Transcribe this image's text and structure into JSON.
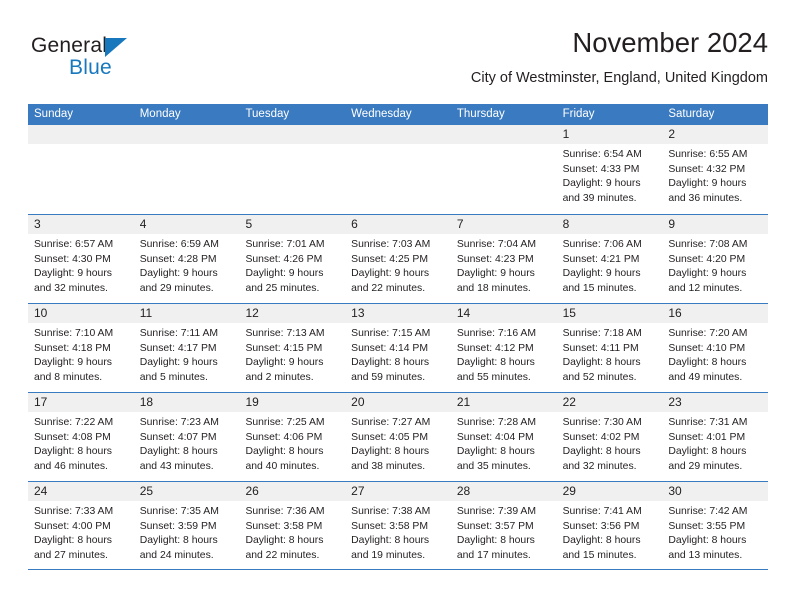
{
  "brand": {
    "name_top": "General",
    "name_bottom": "Blue",
    "accent_color": "#1878be"
  },
  "header": {
    "title": "November 2024",
    "subtitle": "City of Westminster, England, United Kingdom"
  },
  "theme": {
    "header_blue": "#3a7ac0",
    "day_band_gray": "#f0f0f0",
    "text_color": "#231f20"
  },
  "weekdays": [
    "Sunday",
    "Monday",
    "Tuesday",
    "Wednesday",
    "Thursday",
    "Friday",
    "Saturday"
  ],
  "weeks": [
    [
      {
        "empty": true
      },
      {
        "empty": true
      },
      {
        "empty": true
      },
      {
        "empty": true
      },
      {
        "empty": true
      },
      {
        "day": "1",
        "l1": "Sunrise: 6:54 AM",
        "l2": "Sunset: 4:33 PM",
        "l3": "Daylight: 9 hours",
        "l4": "and 39 minutes."
      },
      {
        "day": "2",
        "l1": "Sunrise: 6:55 AM",
        "l2": "Sunset: 4:32 PM",
        "l3": "Daylight: 9 hours",
        "l4": "and 36 minutes."
      }
    ],
    [
      {
        "day": "3",
        "l1": "Sunrise: 6:57 AM",
        "l2": "Sunset: 4:30 PM",
        "l3": "Daylight: 9 hours",
        "l4": "and 32 minutes."
      },
      {
        "day": "4",
        "l1": "Sunrise: 6:59 AM",
        "l2": "Sunset: 4:28 PM",
        "l3": "Daylight: 9 hours",
        "l4": "and 29 minutes."
      },
      {
        "day": "5",
        "l1": "Sunrise: 7:01 AM",
        "l2": "Sunset: 4:26 PM",
        "l3": "Daylight: 9 hours",
        "l4": "and 25 minutes."
      },
      {
        "day": "6",
        "l1": "Sunrise: 7:03 AM",
        "l2": "Sunset: 4:25 PM",
        "l3": "Daylight: 9 hours",
        "l4": "and 22 minutes."
      },
      {
        "day": "7",
        "l1": "Sunrise: 7:04 AM",
        "l2": "Sunset: 4:23 PM",
        "l3": "Daylight: 9 hours",
        "l4": "and 18 minutes."
      },
      {
        "day": "8",
        "l1": "Sunrise: 7:06 AM",
        "l2": "Sunset: 4:21 PM",
        "l3": "Daylight: 9 hours",
        "l4": "and 15 minutes."
      },
      {
        "day": "9",
        "l1": "Sunrise: 7:08 AM",
        "l2": "Sunset: 4:20 PM",
        "l3": "Daylight: 9 hours",
        "l4": "and 12 minutes."
      }
    ],
    [
      {
        "day": "10",
        "l1": "Sunrise: 7:10 AM",
        "l2": "Sunset: 4:18 PM",
        "l3": "Daylight: 9 hours",
        "l4": "and 8 minutes."
      },
      {
        "day": "11",
        "l1": "Sunrise: 7:11 AM",
        "l2": "Sunset: 4:17 PM",
        "l3": "Daylight: 9 hours",
        "l4": "and 5 minutes."
      },
      {
        "day": "12",
        "l1": "Sunrise: 7:13 AM",
        "l2": "Sunset: 4:15 PM",
        "l3": "Daylight: 9 hours",
        "l4": "and 2 minutes."
      },
      {
        "day": "13",
        "l1": "Sunrise: 7:15 AM",
        "l2": "Sunset: 4:14 PM",
        "l3": "Daylight: 8 hours",
        "l4": "and 59 minutes."
      },
      {
        "day": "14",
        "l1": "Sunrise: 7:16 AM",
        "l2": "Sunset: 4:12 PM",
        "l3": "Daylight: 8 hours",
        "l4": "and 55 minutes."
      },
      {
        "day": "15",
        "l1": "Sunrise: 7:18 AM",
        "l2": "Sunset: 4:11 PM",
        "l3": "Daylight: 8 hours",
        "l4": "and 52 minutes."
      },
      {
        "day": "16",
        "l1": "Sunrise: 7:20 AM",
        "l2": "Sunset: 4:10 PM",
        "l3": "Daylight: 8 hours",
        "l4": "and 49 minutes."
      }
    ],
    [
      {
        "day": "17",
        "l1": "Sunrise: 7:22 AM",
        "l2": "Sunset: 4:08 PM",
        "l3": "Daylight: 8 hours",
        "l4": "and 46 minutes."
      },
      {
        "day": "18",
        "l1": "Sunrise: 7:23 AM",
        "l2": "Sunset: 4:07 PM",
        "l3": "Daylight: 8 hours",
        "l4": "and 43 minutes."
      },
      {
        "day": "19",
        "l1": "Sunrise: 7:25 AM",
        "l2": "Sunset: 4:06 PM",
        "l3": "Daylight: 8 hours",
        "l4": "and 40 minutes."
      },
      {
        "day": "20",
        "l1": "Sunrise: 7:27 AM",
        "l2": "Sunset: 4:05 PM",
        "l3": "Daylight: 8 hours",
        "l4": "and 38 minutes."
      },
      {
        "day": "21",
        "l1": "Sunrise: 7:28 AM",
        "l2": "Sunset: 4:04 PM",
        "l3": "Daylight: 8 hours",
        "l4": "and 35 minutes."
      },
      {
        "day": "22",
        "l1": "Sunrise: 7:30 AM",
        "l2": "Sunset: 4:02 PM",
        "l3": "Daylight: 8 hours",
        "l4": "and 32 minutes."
      },
      {
        "day": "23",
        "l1": "Sunrise: 7:31 AM",
        "l2": "Sunset: 4:01 PM",
        "l3": "Daylight: 8 hours",
        "l4": "and 29 minutes."
      }
    ],
    [
      {
        "day": "24",
        "l1": "Sunrise: 7:33 AM",
        "l2": "Sunset: 4:00 PM",
        "l3": "Daylight: 8 hours",
        "l4": "and 27 minutes."
      },
      {
        "day": "25",
        "l1": "Sunrise: 7:35 AM",
        "l2": "Sunset: 3:59 PM",
        "l3": "Daylight: 8 hours",
        "l4": "and 24 minutes."
      },
      {
        "day": "26",
        "l1": "Sunrise: 7:36 AM",
        "l2": "Sunset: 3:58 PM",
        "l3": "Daylight: 8 hours",
        "l4": "and 22 minutes."
      },
      {
        "day": "27",
        "l1": "Sunrise: 7:38 AM",
        "l2": "Sunset: 3:58 PM",
        "l3": "Daylight: 8 hours",
        "l4": "and 19 minutes."
      },
      {
        "day": "28",
        "l1": "Sunrise: 7:39 AM",
        "l2": "Sunset: 3:57 PM",
        "l3": "Daylight: 8 hours",
        "l4": "and 17 minutes."
      },
      {
        "day": "29",
        "l1": "Sunrise: 7:41 AM",
        "l2": "Sunset: 3:56 PM",
        "l3": "Daylight: 8 hours",
        "l4": "and 15 minutes."
      },
      {
        "day": "30",
        "l1": "Sunrise: 7:42 AM",
        "l2": "Sunset: 3:55 PM",
        "l3": "Daylight: 8 hours",
        "l4": "and 13 minutes."
      }
    ]
  ]
}
